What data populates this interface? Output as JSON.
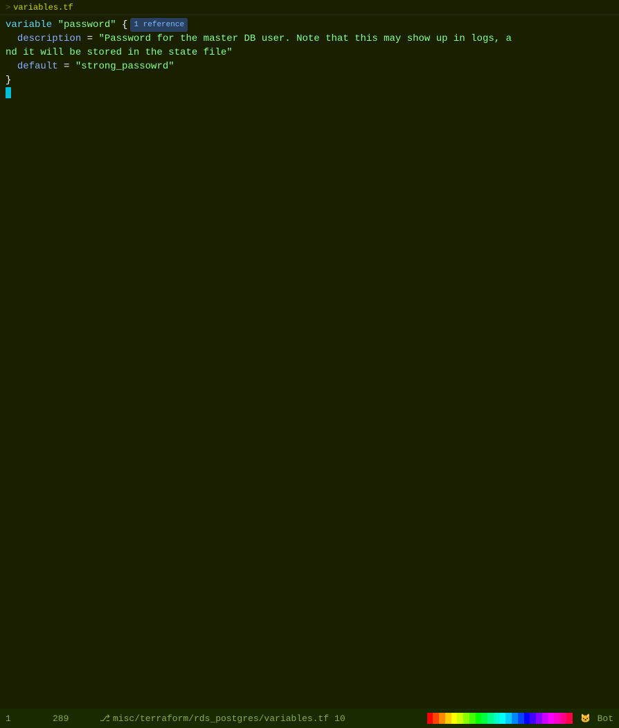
{
  "tab": {
    "arrow": ">",
    "filename": "variables.tf"
  },
  "code": {
    "lines": [
      {
        "id": 1,
        "parts": [
          {
            "type": "variable",
            "text": "variable "
          },
          {
            "type": "string",
            "text": "\"password\""
          },
          {
            "type": "brace",
            "text": " {"
          },
          {
            "type": "ref-badge",
            "text": "1 reference"
          }
        ]
      },
      {
        "id": 2,
        "parts": [
          {
            "type": "indent",
            "text": "  "
          },
          {
            "type": "description",
            "text": "description"
          },
          {
            "type": "equals",
            "text": " = "
          },
          {
            "type": "string",
            "text": "\"Password for the master DB user. Note that this may show up in logs, a"
          }
        ]
      },
      {
        "id": 3,
        "parts": [
          {
            "type": "string-cont",
            "text": "nd it will be stored in the state file\""
          }
        ]
      },
      {
        "id": 4,
        "parts": [
          {
            "type": "indent",
            "text": "  "
          },
          {
            "type": "default",
            "text": "default"
          },
          {
            "type": "equals",
            "text": " = "
          },
          {
            "type": "string",
            "text": "\"strong_passowrd\""
          }
        ]
      },
      {
        "id": 5,
        "parts": [
          {
            "type": "brace",
            "text": "}"
          }
        ]
      },
      {
        "id": 6,
        "parts": [
          {
            "type": "cursor",
            "text": ""
          }
        ]
      }
    ]
  },
  "statusBar": {
    "line": "1",
    "col": "289",
    "branchIcon": "⎇",
    "path": "misc/terraform/rds_postgres/variables.tf",
    "colPos": "10",
    "botLabel": "Bot"
  },
  "rainbow": {
    "colors": [
      "#ff0000",
      "#ff4400",
      "#ff8800",
      "#ffcc00",
      "#ffff00",
      "#ccff00",
      "#88ff00",
      "#44ff00",
      "#00ff00",
      "#00ff44",
      "#00ff88",
      "#00ffcc",
      "#00ffff",
      "#00ccff",
      "#0088ff",
      "#0044ff",
      "#0000ff",
      "#4400ff",
      "#8800ff",
      "#cc00ff",
      "#ff00ff",
      "#ff00cc",
      "#ff0088",
      "#ff0044"
    ]
  }
}
